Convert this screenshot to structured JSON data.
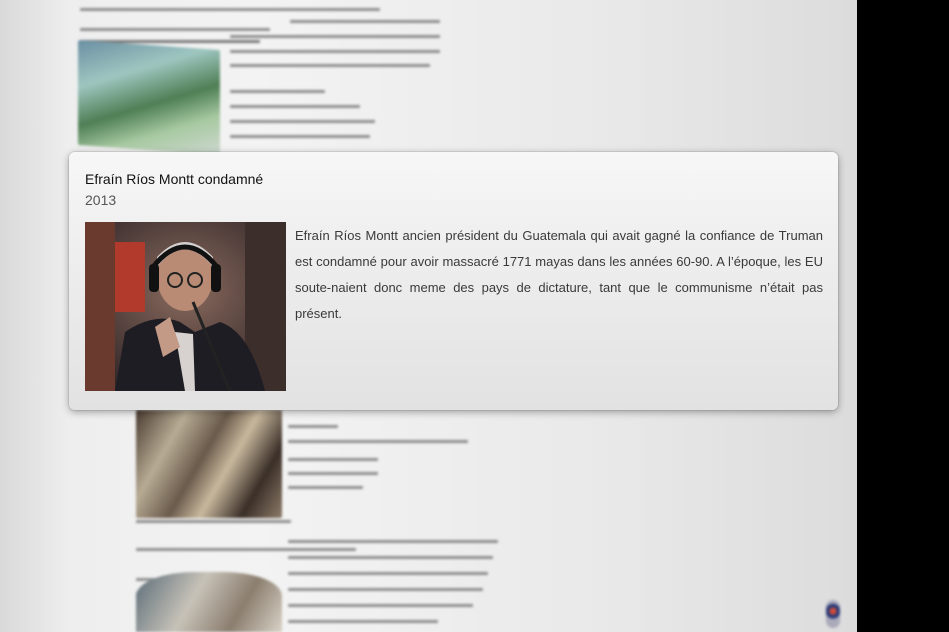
{
  "card": {
    "title": "Efraín Ríos Montt condamné",
    "year": "2013",
    "photo_alt": "Efraín Ríos Montt pointing finger, wearing headphones",
    "body": "Efraín Ríos Montt ancien président du Guatemala qui avait gagné la confiance de Truman est condamné pour avoir massacré 1771 mayas dans les années 60-90. A l’époque, les EU soute-naient donc meme des pays de dictature, tant que le communisme n’était pas présent."
  },
  "colors": {
    "page_background": "#f0f0f0",
    "card_background": "#f2f2f2",
    "side_black": "#000000"
  }
}
